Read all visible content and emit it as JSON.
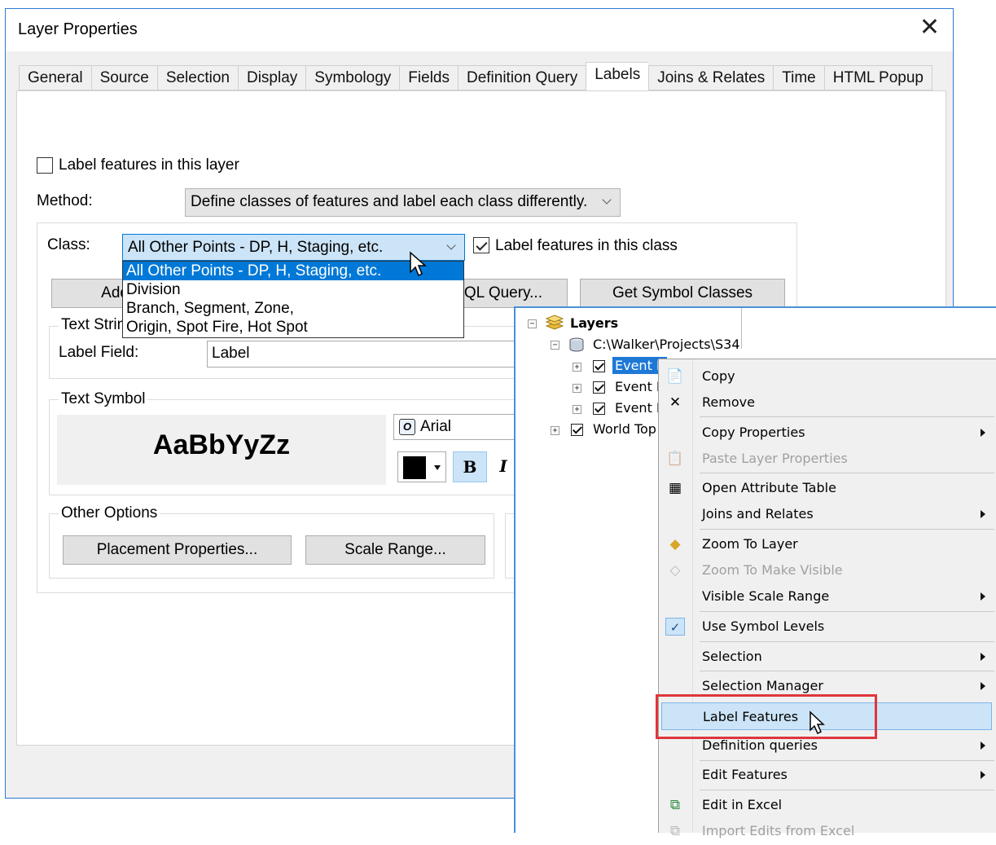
{
  "dialog": {
    "title": "Layer Properties",
    "tabs": [
      "General",
      "Source",
      "Selection",
      "Display",
      "Symbology",
      "Fields",
      "Definition Query",
      "Labels",
      "Joins & Relates",
      "Time",
      "HTML Popup"
    ],
    "active_tab": "Labels"
  },
  "labels": {
    "label_features_layer": "Label features in this layer",
    "method_label": "Method:",
    "method_value": "Define classes of features and label each class differently.",
    "class_label": "Class:",
    "class_value": "All Other Points - DP, H, Staging, etc.",
    "label_features_class": "Label features in this class",
    "add_button": "Add...",
    "sql_button": "SQL Query...",
    "get_symbol_button": "Get Symbol Classes",
    "text_string_group": "Text String",
    "label_field_label": "Label Field:",
    "label_field_value": "Label",
    "text_symbol_group": "Text Symbol",
    "preview_text": "AaBbYyZz",
    "font_name": "Arial",
    "bold": "B",
    "italic": "I",
    "other_options_group": "Other Options",
    "placement_button": "Placement Properties...",
    "scale_button": "Scale Range..."
  },
  "class_dropdown": {
    "options": [
      "All Other Points - DP, H, Staging, etc.",
      "Division",
      "Branch, Segment, Zone,",
      "Origin, Spot Fire, Hot Spot"
    ]
  },
  "toc": {
    "layers": "Layers",
    "path": "C:\\Walker\\Projects\\S34",
    "items": [
      "Event P",
      "Event L",
      "Event P"
    ],
    "world": "World Top"
  },
  "context_menu": {
    "items": [
      {
        "label": "Copy",
        "icon": "copy-icon",
        "glyph": "📄"
      },
      {
        "label": "Remove",
        "icon": "remove-icon",
        "glyph": "✕"
      },
      {
        "label": "Copy Properties",
        "icon": "",
        "glyph": ""
      },
      {
        "label": "Paste Layer Properties",
        "icon": "paste-icon",
        "glyph": "📋"
      },
      {
        "label": "Open Attribute Table",
        "icon": "table-icon",
        "glyph": "▦"
      },
      {
        "label": "Joins and Relates",
        "icon": "",
        "glyph": ""
      },
      {
        "label": "Zoom To Layer",
        "icon": "zoom-to-layer-icon",
        "glyph": "◆"
      },
      {
        "label": "Zoom To Make Visible",
        "icon": "zoom-visible-icon",
        "glyph": "◇"
      },
      {
        "label": "Visible Scale Range",
        "icon": "",
        "glyph": ""
      },
      {
        "label": "Use Symbol Levels",
        "icon": "check-icon",
        "glyph": "✓"
      },
      {
        "label": "Selection",
        "icon": "",
        "glyph": ""
      },
      {
        "label": "Selection Manager",
        "icon": "",
        "glyph": ""
      },
      {
        "label": "Label Features",
        "icon": "",
        "glyph": ""
      },
      {
        "label": "Definition queries",
        "icon": "",
        "glyph": ""
      },
      {
        "label": "Edit Features",
        "icon": "",
        "glyph": ""
      },
      {
        "label": "Edit in Excel",
        "icon": "excel-icon",
        "glyph": "⧉"
      },
      {
        "label": "Import Edits from Excel",
        "icon": "import-icon",
        "glyph": "⧉"
      }
    ],
    "highlighted": "Label Features",
    "highlight_color": "#cce4f7",
    "callout_color": "#e0353b"
  }
}
